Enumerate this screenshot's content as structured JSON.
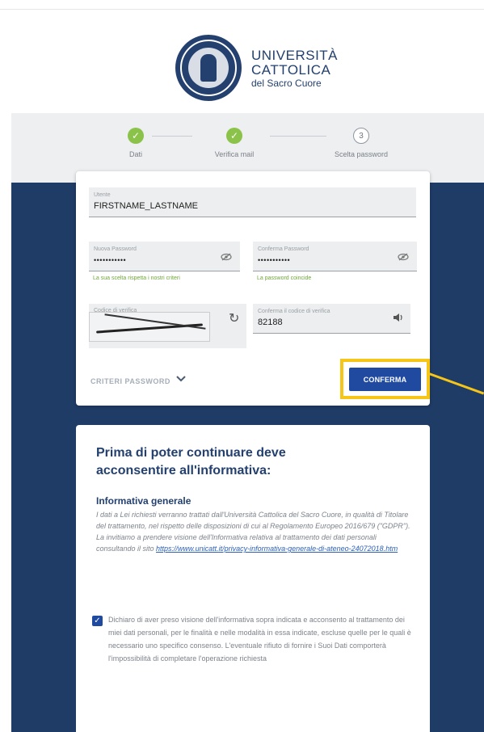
{
  "logo": {
    "line1": "UNIVERSITÀ",
    "line2": "CATTOLICA",
    "line3": "del Sacro Cuore"
  },
  "stepper": {
    "steps": [
      {
        "label": "Dati",
        "state": "done",
        "marker": "✓"
      },
      {
        "label": "Verifica mail",
        "state": "done",
        "marker": "✓"
      },
      {
        "label": "Scelta password",
        "state": "current",
        "marker": "3"
      }
    ]
  },
  "form": {
    "username": {
      "label": "Utente",
      "value": "FIRSTNAME_LASTNAME"
    },
    "new_password": {
      "label": "Nuova Password",
      "value": "•••••••••••",
      "hint": "La sua scelta rispetta i nostri criteri"
    },
    "confirm_password": {
      "label": "Conferma Password",
      "value": "•••••••••••",
      "hint": "La password coincide"
    },
    "captcha": {
      "label": "Codice di verifica"
    },
    "captcha_confirm": {
      "label": "Conferma il codice di verifica",
      "value": "82188"
    },
    "criteri_label": "CRITERI PASSWORD",
    "submit_label": "CONFERMA"
  },
  "informativa": {
    "title": "Prima di poter continuare deve acconsentire all'informativa:",
    "subtitle": "Informativa generale",
    "body_1": "I dati a Lei richiesti verranno trattati dall'Università Cattolica del Sacro Cuore, in qualità di Titolare del trattamento, nel rispetto delle disposizioni di cui al Regolamento Europeo 2016/679 (\"GDPR\").",
    "body_2": "La invitiamo a prendere visione dell'Informativa relativa al trattamento dei dati personali consultando il sito ",
    "link": "https://www.unicatt.it/privacy-informativa-generale-di-ateneo-24072018.htm",
    "declaration": "Dichiaro di aver preso visione dell'informativa sopra indicata e acconsento al trattamento dei miei dati personali, per le finalità e nelle modalità in essa indicate, escluse quelle per le quali è necessario uno specifico consenso. L'eventuale rifiuto di fornire i Suoi Dati comporterà l'impossibilità di completare l'operazione richiesta",
    "consent_checked": true
  },
  "colors": {
    "brand_blue": "#23406f",
    "button_blue": "#1f4aa0",
    "success_green": "#8bc34a",
    "highlight_yellow": "#f5c518"
  }
}
